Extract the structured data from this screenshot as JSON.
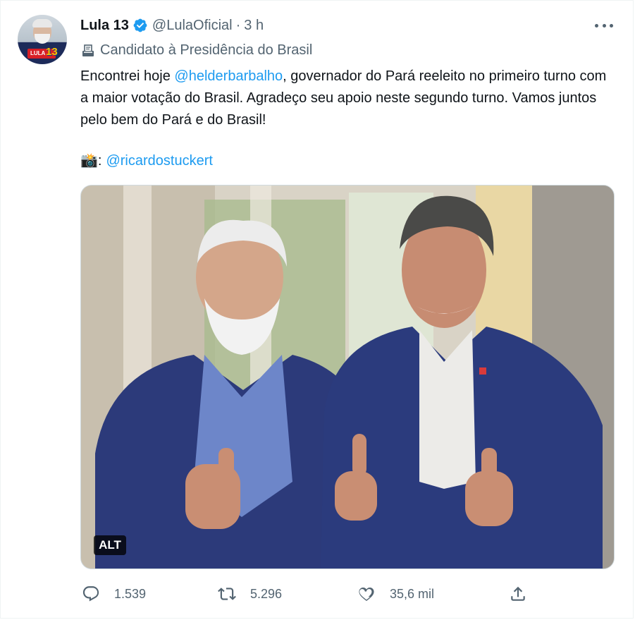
{
  "tweet": {
    "author_name": "Lula 13",
    "handle": "@LulaOficial",
    "separator": "·",
    "time": "3 h",
    "label": "Candidato à Presidência do Brasil",
    "text_before_mention": "Encontrei hoje ",
    "mention": "@helderbarbalho",
    "text_after_mention": ", governador do Pará reeleito no primeiro turno com a maior votação do Brasil. Agradeço seu apoio neste segundo turno. Vamos juntos pelo bem do Pará e do Brasil!",
    "credit_emoji": "📸",
    "credit_colon": ":",
    "credit_mention": "@ricardostuckert",
    "avatar_badge": "LULA",
    "avatar_number": "13",
    "alt_label": "ALT"
  },
  "actions": {
    "replies": "1.539",
    "retweets": "5.296",
    "likes": "35,6 mil"
  },
  "colors": {
    "accent": "#1d9bf0",
    "secondary_text": "#536471",
    "primary_text": "#0f1419",
    "suit_blue": "#2c3a7a"
  },
  "icons": {
    "verified": "verified-badge-icon",
    "more": "more-dots-icon",
    "label": "ballot-box-icon",
    "reply": "reply-icon",
    "retweet": "retweet-icon",
    "like": "heart-icon",
    "share": "share-icon"
  }
}
